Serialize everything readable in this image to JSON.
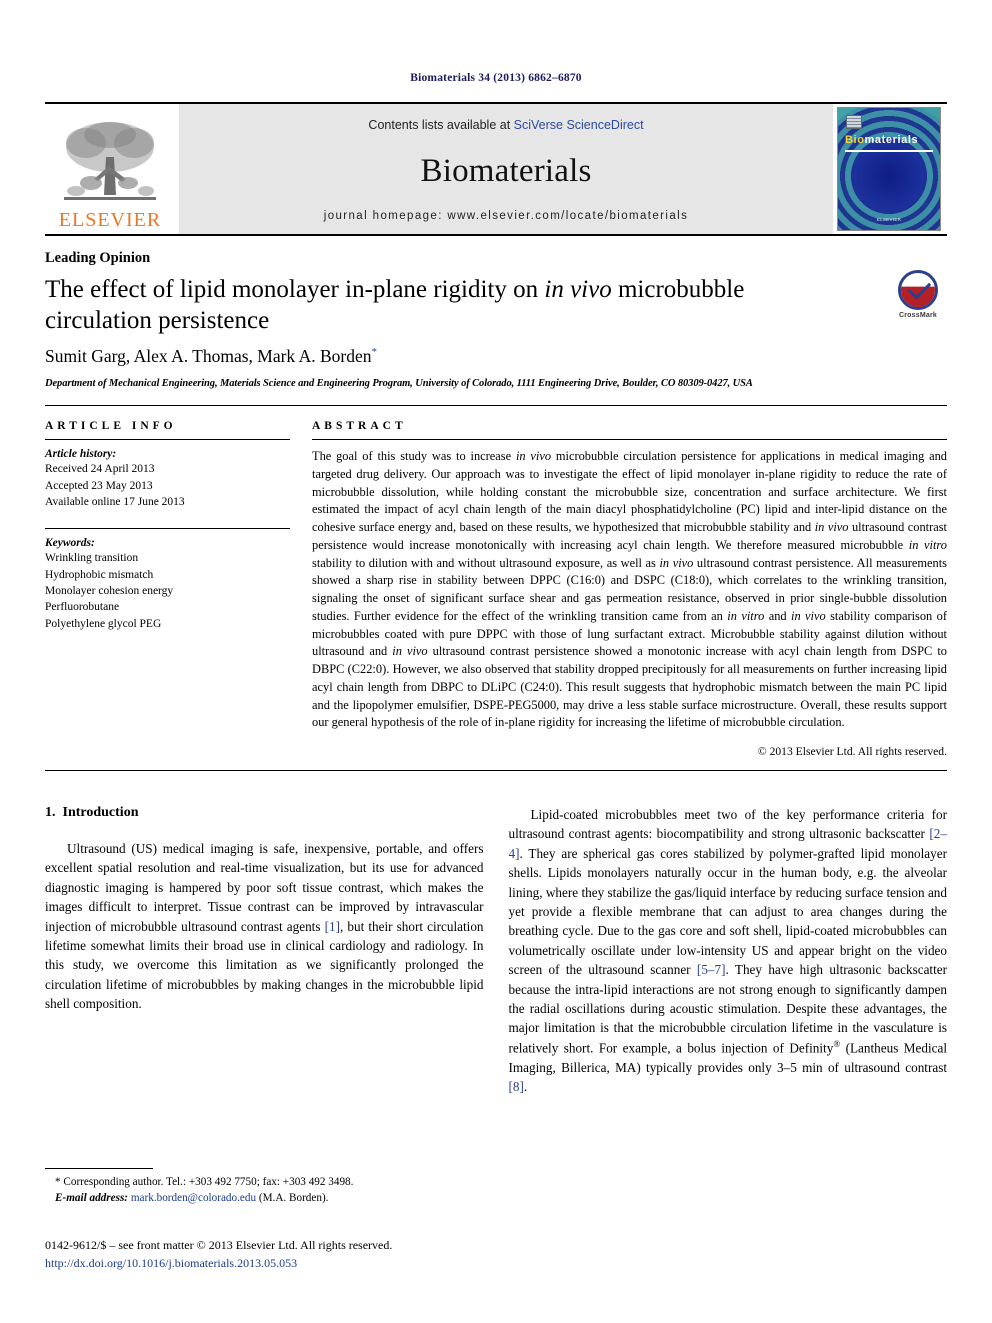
{
  "running_head": "Biomaterials 34 (2013) 6862–6870",
  "masthead": {
    "publisher_name": "ELSEVIER",
    "contents_prefix": "Contents lists available at ",
    "contents_link": "SciVerse ScienceDirect",
    "journal_title": "Biomaterials",
    "homepage": "journal homepage: www.elsevier.com/locate/biomaterials",
    "cover": {
      "title_bio": "Bio",
      "title_materials": "materials",
      "foot": "ELSEVIER"
    }
  },
  "article": {
    "type": "Leading Opinion",
    "title_part1": "The effect of lipid monolayer in-plane rigidity on ",
    "title_italic": "in vivo",
    "title_part2": " microbubble circulation persistence",
    "authors": "Sumit Garg, Alex A. Thomas, Mark A. Borden",
    "author_marker": "*",
    "affiliation": "Department of Mechanical Engineering, Materials Science and Engineering Program, University of Colorado, 1111 Engineering Drive, Boulder, CO 80309-0427, USA",
    "crossmark_label": "CrossMark"
  },
  "article_info": {
    "heading": "ARTICLE INFO",
    "history_label": "Article history:",
    "history": [
      "Received 24 April 2013",
      "Accepted 23 May 2013",
      "Available online 17 June 2013"
    ],
    "keywords_label": "Keywords:",
    "keywords": [
      "Wrinkling transition",
      "Hydrophobic mismatch",
      "Monolayer cohesion energy",
      "Perfluorobutane",
      "Polyethylene glycol PEG"
    ]
  },
  "abstract": {
    "heading": "ABSTRACT",
    "paragraphs": [
      "The goal of this study was to increase ",
      " microbubble circulation persistence for applications in medical imaging and targeted drug delivery. Our approach was to investigate the effect of lipid monolayer in-plane rigidity to reduce the rate of microbubble dissolution, while holding constant the microbubble size, concentration and surface architecture. We first estimated the impact of acyl chain length of the main diacyl phosphatidylcholine (PC) lipid and inter-lipid distance on the cohesive surface energy and, based on these results, we hypothesized that microbubble stability and ",
      " ultrasound contrast persistence would increase monotonically with increasing acyl chain length. We therefore measured microbubble ",
      " stability to dilution with and without ultrasound exposure, as well as ",
      " ultrasound contrast persistence. All measurements showed a sharp rise in stability between DPPC (C16:0) and DSPC (C18:0), which correlates to the wrinkling transition, signaling the onset of significant surface shear and gas permeation resistance, observed in prior single-bubble dissolution studies. Further evidence for the effect of the wrinkling transition came from an ",
      " and ",
      " stability comparison of microbubbles coated with pure DPPC with those of lung surfactant extract. Microbubble stability against dilution without ultrasound and ",
      " ultrasound contrast persistence showed a monotonic increase with acyl chain length from DSPC to DBPC (C22:0). However, we also observed that stability dropped precipitously for all measurements on further increasing lipid acyl chain length from DBPC to DLiPC (C24:0). This result suggests that hydrophobic mismatch between the main PC lipid and the lipopolymer emulsifier, DSPE-PEG5000, may drive a less stable surface microstructure. Overall, these results support our general hypothesis of the role of in-plane rigidity for increasing the lifetime of microbubble circulation."
    ],
    "italics": {
      "in_vivo": "in vivo",
      "in_vitro": "in vitro"
    },
    "copyright": "© 2013 Elsevier Ltd. All rights reserved."
  },
  "introduction": {
    "section_number": "1.",
    "section_title": "Introduction",
    "left_paragraph": "Ultrasound (US) medical imaging is safe, inexpensive, portable, and offers excellent spatial resolution and real-time visualization, but its use for advanced diagnostic imaging is hampered by poor soft tissue contrast, which makes the images difficult to interpret. Tissue contrast can be improved by intravascular injection of microbubble ultrasound contrast agents ",
    "left_ref1": "[1]",
    "left_paragraph_cont": ", but their short circulation lifetime somewhat limits their broad use in clinical cardiology and radiology. In this study, we overcome this limitation as we significantly prolonged the circulation lifetime of microbubbles by making changes in the microbubble lipid shell composition.",
    "right_p1": "Lipid-coated microbubbles meet two of the key performance criteria for ultrasound contrast agents: biocompatibility and strong ultrasonic backscatter ",
    "right_ref1": "[2–4]",
    "right_p2": ". They are spherical gas cores stabilized by polymer-grafted lipid monolayer shells. Lipids monolayers naturally occur in the human body, e.g. the alveolar lining, where they stabilize the gas/liquid interface by reducing surface tension and yet provide a flexible membrane that can adjust to area changes during the breathing cycle. Due to the gas core and soft shell, lipid-coated microbubbles can volumetrically oscillate under low-intensity US and appear bright on the video screen of the ultrasound scanner ",
    "right_ref2": "[5–7]",
    "right_p3": ". They have high ultrasonic backscatter because the intra-lipid interactions are not strong enough to significantly dampen the radial oscillations during acoustic stimulation. Despite these advantages, the major limitation is that the microbubble circulation lifetime in the vasculature is relatively short. For example, a bolus injection of Definity",
    "right_sup": "®",
    "right_p4": " (Lantheus Medical Imaging, Billerica, MA) typically provides only 3–5 min of ultrasound contrast ",
    "right_ref3": "[8]",
    "right_p5": "."
  },
  "footnote": {
    "corresponding": "* Corresponding author. Tel.: +303 492 7750; fax: +303 492 3498.",
    "email_label": "E-mail address:",
    "email": "mark.borden@colorado.edu",
    "email_suffix": " (M.A. Borden)."
  },
  "imprint": {
    "issn_line": "0142-9612/$ – see front matter © 2013 Elsevier Ltd. All rights reserved.",
    "doi": "http://dx.doi.org/10.1016/j.biomaterials.2013.05.053"
  },
  "colors": {
    "link": "#1a3a8f",
    "elsevier_orange": "#ef7622",
    "running_head": "#1a1a5e",
    "band_gray": "#e6e6e6"
  }
}
